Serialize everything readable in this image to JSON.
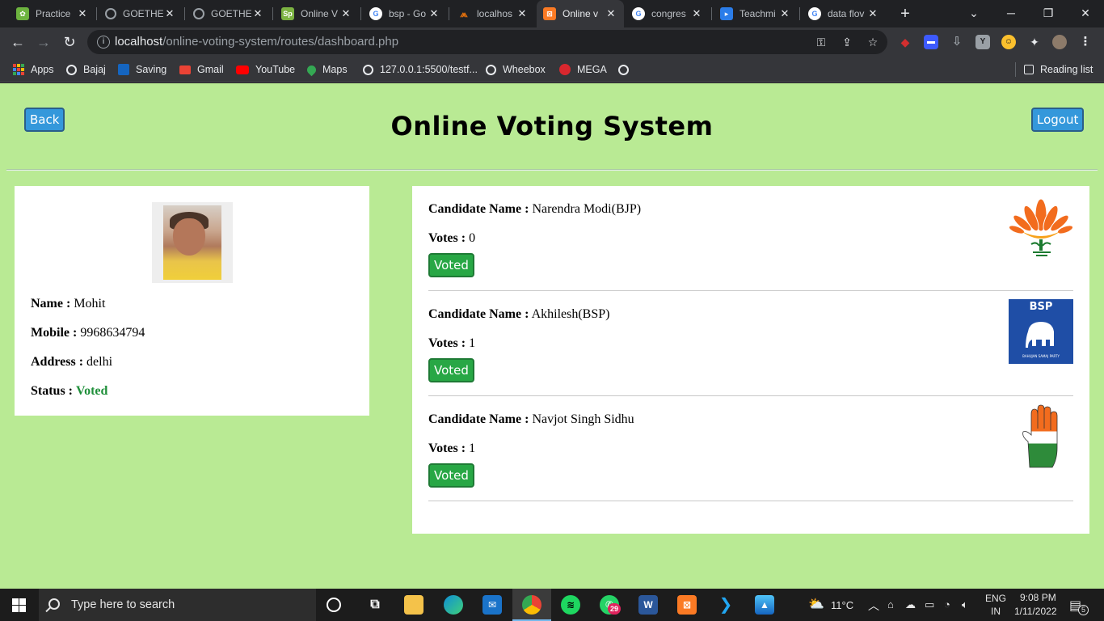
{
  "browser": {
    "tabs": [
      {
        "title": "Practice",
        "favicon": "leaf-icon",
        "color": "#6db33f",
        "active": false
      },
      {
        "title": "GOETHE",
        "favicon": "globe-icon",
        "color": "#9aa0a6",
        "active": false
      },
      {
        "title": "GOETHE",
        "favicon": "globe-icon",
        "color": "#9aa0a6",
        "active": false
      },
      {
        "title": "Online V",
        "favicon": "sp-icon",
        "color": "#7cb342",
        "active": false
      },
      {
        "title": "bsp - Go",
        "favicon": "google-icon",
        "color": "#4285f4",
        "active": false
      },
      {
        "title": "localhos",
        "favicon": "xampp-icon",
        "color": "#e8720c",
        "active": false
      },
      {
        "title": "Online v",
        "favicon": "xampp-icon",
        "color": "#fb7a24",
        "active": true
      },
      {
        "title": "congres",
        "favicon": "google-icon",
        "color": "#4285f4",
        "active": false
      },
      {
        "title": "Teachmi",
        "favicon": "teachmint-icon",
        "color": "#2b7de9",
        "active": false
      },
      {
        "title": "data flov",
        "favicon": "google-icon",
        "color": "#4285f4",
        "active": false
      }
    ],
    "new_tab": "+",
    "url_host": "localhost",
    "url_path": "/online-voting-system/routes/dashboard.php",
    "bookmarks": [
      {
        "label": "Apps",
        "icon": "apps-grid-icon",
        "color": "#ea4335"
      },
      {
        "label": "Bajaj",
        "icon": "globe-icon",
        "color": "#e8eaed"
      },
      {
        "label": "Saving",
        "icon": "uco-icon",
        "color": "#1565c0"
      },
      {
        "label": "Gmail",
        "icon": "gmail-icon",
        "color": "#ea4335"
      },
      {
        "label": "YouTube",
        "icon": "youtube-icon",
        "color": "#ff0000"
      },
      {
        "label": "Maps",
        "icon": "maps-icon",
        "color": "#34a853"
      },
      {
        "label": "127.0.0.1:5500/testf...",
        "icon": "globe-icon",
        "color": "#e8eaed"
      },
      {
        "label": "Wheebox",
        "icon": "globe-icon",
        "color": "#e8eaed"
      },
      {
        "label": "MEGA",
        "icon": "mega-icon",
        "color": "#d9272e"
      },
      {
        "label": "",
        "icon": "globe-icon",
        "color": "#e8eaed"
      }
    ],
    "reading_list": "Reading list"
  },
  "header": {
    "back_label": "Back",
    "title": "Online Voting System",
    "logout_label": "Logout"
  },
  "profile": {
    "name_label": "Name :",
    "name": "Mohit",
    "mobile_label": "Mobile :",
    "mobile": "9968634794",
    "address_label": "Address :",
    "address": "delhi",
    "status_label": "Status :",
    "status": "Voted",
    "status_color": "#1f8f3a"
  },
  "candidates": [
    {
      "name_label": "Candidate Name :",
      "name": "Narendra Modi(BJP)",
      "votes_label": "Votes :",
      "votes": "0",
      "button": "Voted",
      "logo": "lotus-icon"
    },
    {
      "name_label": "Candidate Name :",
      "name": "Akhilesh(BSP)",
      "votes_label": "Votes :",
      "votes": "1",
      "button": "Voted",
      "logo": "elephant-icon",
      "logo_text": "BSP",
      "logo_sub": "BAHUJAN SAMAJ PARTY"
    },
    {
      "name_label": "Candidate Name :",
      "name": "Navjot Singh Sidhu",
      "votes_label": "Votes :",
      "votes": "1",
      "button": "Voted",
      "logo": "hand-icon"
    }
  ],
  "taskbar": {
    "search_placeholder": "Type here to search",
    "whatsapp_badge": "29",
    "weather": "11°C",
    "lang_top": "ENG",
    "lang_bottom": "IN",
    "time": "9:08 PM",
    "date": "1/11/2022",
    "notifications": "5"
  }
}
